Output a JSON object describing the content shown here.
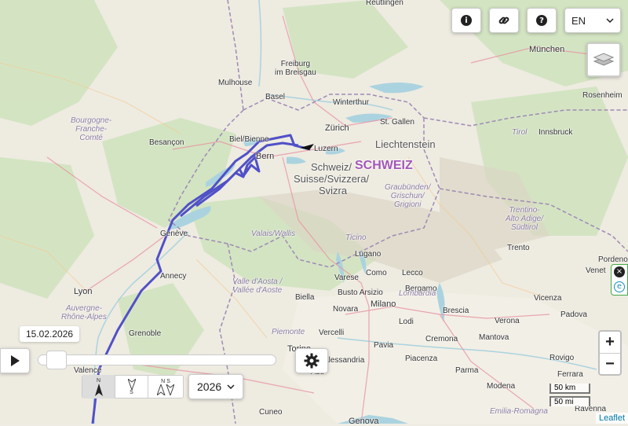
{
  "date_label": "15.02.2026",
  "year_select": {
    "value": "2026",
    "options": [
      "2026"
    ]
  },
  "language": {
    "value": "EN"
  },
  "zoom": {
    "in": "+",
    "out": "−"
  },
  "scale": {
    "metric": "50 km",
    "imperial": "50 mi"
  },
  "attribution": "Leaflet",
  "timeline_progress": 0.04,
  "direction_buttons": {
    "north": "N",
    "south": "S",
    "both_n": "N",
    "both_s": "S"
  },
  "icons": {
    "info": "info-icon",
    "link": "link-icon",
    "help": "help-icon",
    "layers": "layers-icon",
    "settings": "gear-icon",
    "play": "play-icon"
  },
  "colors": {
    "track": "#5050c8",
    "swiss_label": "#a256b8",
    "lake": "#aad3df",
    "border": "#9e8ab4"
  },
  "places": {
    "reutlingen": "Reutlingen",
    "freiburg1": "Freiburg",
    "freiburg2": "im Breisgau",
    "munchen": "München",
    "mulhouse": "Mulhouse",
    "basel": "Basel",
    "winterthur": "Winterthur",
    "zurich": "Zürich",
    "stgallen": "St. Gallen",
    "rosenheim": "Rosenheim",
    "bourgogne1": "Bourgogne-",
    "bourgogne2": "Franche-",
    "bourgogne3": "Comté",
    "besancon": "Besançon",
    "biel": "Biel/Bienne",
    "luzern": "Luzern",
    "liechtenstein": "Liechtenstein",
    "tirol": "Tirol",
    "innsbruck": "Innsbruck",
    "bern": "Bern",
    "schweiz_a": "Schweiz/",
    "schweiz_b": "SCHWEIZ",
    "schweiz_c": "Suisse/Svizzera/",
    "schweiz_d": "Svizra",
    "graub1": "Graubünden/",
    "graub2": "Grischun/",
    "graub3": "Grigioni",
    "trentino1": "Trentino-",
    "trentino2": "Alto Adige/",
    "trentino3": "Südtirol",
    "valais": "Valais/Wallis",
    "geneve": "Genève",
    "annecy": "Annecy",
    "ticino": "Ticino",
    "lugano": "Lugano",
    "trento": "Trento",
    "pordenone": "Pordenone",
    "venet": "Venet",
    "lyon": "Lyon",
    "auvergne1": "Auvergne-",
    "auvergne2": "Rhône-Alpes",
    "aosta1": "Valle d'Aosta /",
    "aosta2": "Vallée d'Aoste",
    "varese": "Varese",
    "como": "Como",
    "lecco": "Lecco",
    "biella": "Biella",
    "busto": "Busto Arsizio",
    "bergamo": "Bergamo",
    "lombardia": "Lombardia",
    "vicenza": "Vicenza",
    "milano": "Milano",
    "novara": "Novara",
    "brescia": "Brescia",
    "verona": "Verona",
    "padova": "Padova",
    "grenoble": "Grenoble",
    "lodi": "Lodi",
    "piemonte": "Piemonte",
    "vercelli": "Vercelli",
    "cremona": "Cremona",
    "mantova": "Mantova",
    "torino": "Torino",
    "pavia": "Pavia",
    "piacenza": "Piacenza",
    "rovigo": "Rovigo",
    "valence": "Valence",
    "alessandria": "Alessandria",
    "asti": "Asti",
    "parma": "Parma",
    "ferrara": "Ferrara",
    "modena": "Modena",
    "cuneo": "Cuneo",
    "genova": "Genova",
    "emilia": "Emilia-Romagna",
    "ravenna": "Ravenna"
  }
}
